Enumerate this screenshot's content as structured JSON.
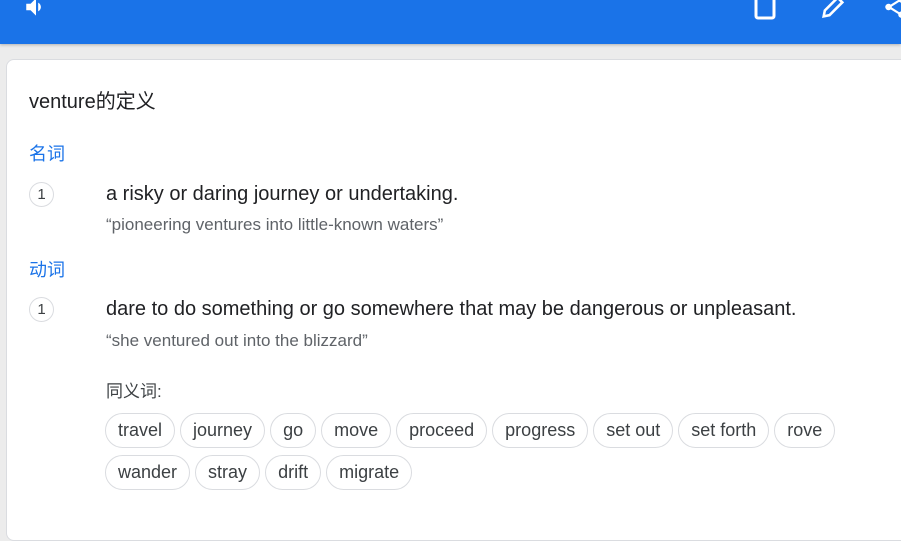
{
  "toolbar": {
    "speaker_icon": "speaker-icon",
    "copy_icon": "copy-icon",
    "edit_icon": "pencil-icon",
    "share_icon": "share-icon",
    "accent_color": "#1a73e8"
  },
  "dictionary": {
    "title": "venture的定义",
    "noun": {
      "pos_label": "名词",
      "number": "1",
      "definition": "a risky or daring journey or undertaking.",
      "example": "“pioneering ventures into little-known waters”"
    },
    "verb": {
      "pos_label": "动词",
      "number": "1",
      "definition": "dare to do something or go somewhere that may be dangerous or unpleasant.",
      "example": "“she ventured out into the blizzard”",
      "synonyms_label": "同义词:",
      "synonyms": [
        "travel",
        "journey",
        "go",
        "move",
        "proceed",
        "progress",
        "set out",
        "set forth",
        "rove",
        "wander",
        "stray",
        "drift",
        "migrate"
      ]
    }
  }
}
